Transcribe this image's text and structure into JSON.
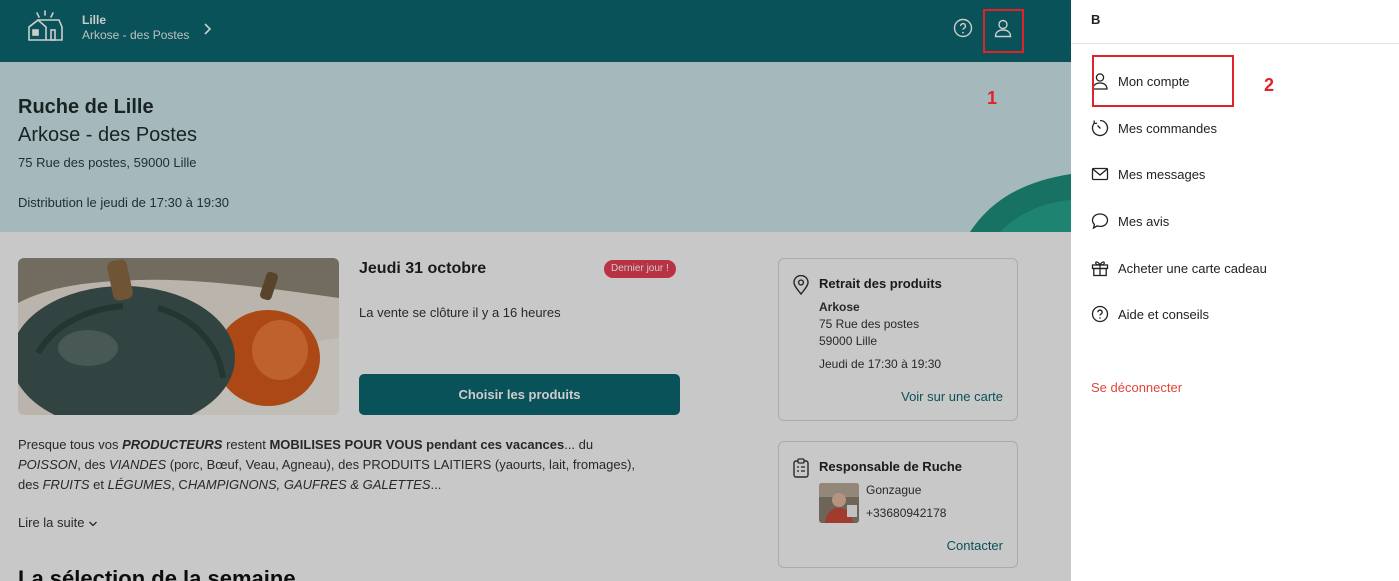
{
  "header": {
    "city": "Lille",
    "hive": "Arkose - des Postes"
  },
  "hero": {
    "title": "Ruche de Lille",
    "subtitle": "Arkose - des Postes",
    "address": "75 Rue des postes, 59000 Lille",
    "distribution": "Distribution le jeudi de 17:30 à 19:30"
  },
  "sale": {
    "date": "Jeudi 31 octobre",
    "badge": "Dernier jour !",
    "closing": "La vente se clôture il y a 16 heures",
    "cta": "Choisir les produits"
  },
  "description": {
    "p1": "Presque tous vos ",
    "producers": "PRODUCTEURS",
    "p2": " restent ",
    "mobilised": "MOBILISES POUR VOUS pendant ces vacances",
    "p3": "... du",
    "fish": "POISSON",
    "p4": ", des ",
    "meats": "VIANDES",
    "p5": " (porc, Bœuf, Veau, Agneau), des PRODUITS LAITIERS (yaourts, lait, fromages),",
    "p6": "des ",
    "fruits": "FRUITS",
    "p7": " et ",
    "vegetables": "LÉGUMES",
    "p8": ", C",
    "mushrooms": "HAMPIGNONS, GAUFRES & GALETTES",
    "p9": "...",
    "read_more": "Lire la suite"
  },
  "selection_title": "La sélection de la semaine",
  "pickup_card": {
    "title": "Retrait des produits",
    "place": "Arkose",
    "street": "75 Rue des postes",
    "city": "59000 Lille",
    "hours": "Jeudi de 17:30 à 19:30",
    "link": "Voir sur une carte"
  },
  "manager_card": {
    "title": "Responsable de Ruche",
    "name": "Gonzague",
    "phone": "+33680942178",
    "link": "Contacter"
  },
  "drawer": {
    "user_initial": "B",
    "items": [
      {
        "label": "Mon compte",
        "icon": "user-icon"
      },
      {
        "label": "Mes commandes",
        "icon": "history-icon"
      },
      {
        "label": "Mes messages",
        "icon": "envelope-icon"
      },
      {
        "label": "Mes avis",
        "icon": "speech-bubble-icon"
      },
      {
        "label": "Acheter une carte cadeau",
        "icon": "gift-icon"
      },
      {
        "label": "Aide et conseils",
        "icon": "help-icon"
      }
    ],
    "logout": "Se déconnecter"
  },
  "annotations": {
    "marker_1": "1",
    "marker_2": "2"
  },
  "colors": {
    "brand": "#0d6770",
    "hero_bg": "#cfe6ea",
    "badge": "#e63f55",
    "logout": "#e0463a",
    "highlight": "#e0232a"
  }
}
